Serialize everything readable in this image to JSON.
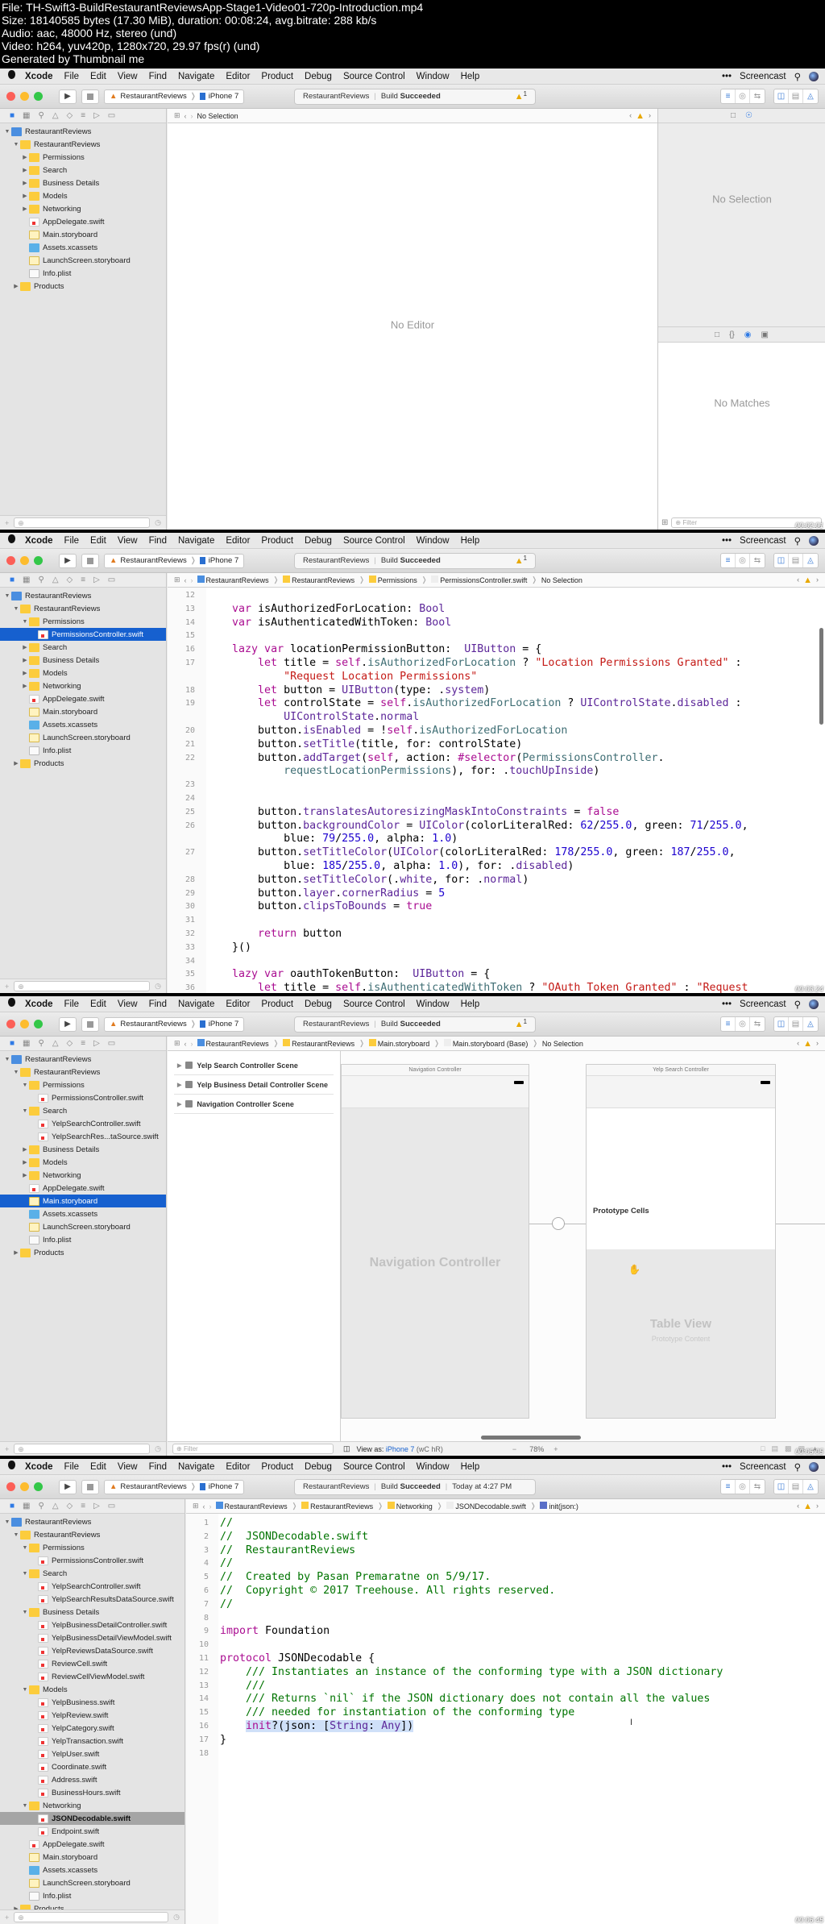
{
  "info": {
    "lines": [
      "File: TH-Swift3-BuildRestaurantReviewsApp-Stage1-Video01-720p-Introduction.mp4",
      "Size: 18140585 bytes (17.30 MiB), duration: 00:08:24, avg.bitrate: 288 kb/s",
      "Audio: aac, 48000 Hz, stereo (und)",
      "Video: h264, yuv420p, 1280x720, 29.97 fps(r) (und)",
      "Generated by Thumbnail me"
    ]
  },
  "menubar": {
    "app": "Xcode",
    "items": [
      "File",
      "Edit",
      "View",
      "Find",
      "Navigate",
      "Editor",
      "Product",
      "Debug",
      "Source Control",
      "Window",
      "Help"
    ],
    "right": [
      "•••",
      "Screencast"
    ],
    "icons": [
      "apple-icon",
      "search-icon",
      "siri-icon"
    ]
  },
  "toolbar": {
    "scheme": "RestaurantReviews",
    "device": "iPhone 7",
    "activity_project": "RestaurantReviews",
    "activity_status_prefix": "Build",
    "activity_status": "Succeeded",
    "warning_count": "1",
    "activity_time": "Today at 4:27 PM"
  },
  "frames": [
    {
      "timestamp": "00:02:01",
      "jumpbar": [
        "No Selection"
      ],
      "editor_message": "No Editor",
      "inspector_top_message": "No Selection",
      "inspector_bottom_message": "No Matches",
      "filter_placeholder": "Filter",
      "tree": [
        {
          "label": "RestaurantReviews",
          "type": "proj",
          "depth": 0,
          "disc": "▼"
        },
        {
          "label": "RestaurantReviews",
          "type": "folder",
          "depth": 1,
          "disc": "▼"
        },
        {
          "label": "Permissions",
          "type": "folder",
          "depth": 2,
          "disc": "▶"
        },
        {
          "label": "Search",
          "type": "folder",
          "depth": 2,
          "disc": "▶"
        },
        {
          "label": "Business Details",
          "type": "folder",
          "depth": 2,
          "disc": "▶"
        },
        {
          "label": "Models",
          "type": "folder",
          "depth": 2,
          "disc": "▶"
        },
        {
          "label": "Networking",
          "type": "folder",
          "depth": 2,
          "disc": "▶"
        },
        {
          "label": "AppDelegate.swift",
          "type": "swift",
          "depth": 2,
          "disc": ""
        },
        {
          "label": "Main.storyboard",
          "type": "sb",
          "depth": 2,
          "disc": ""
        },
        {
          "label": "Assets.xcassets",
          "type": "xc",
          "depth": 2,
          "disc": ""
        },
        {
          "label": "LaunchScreen.storyboard",
          "type": "sb",
          "depth": 2,
          "disc": ""
        },
        {
          "label": "Info.plist",
          "type": "plist",
          "depth": 2,
          "disc": ""
        },
        {
          "label": "Products",
          "type": "folder",
          "depth": 1,
          "disc": "▶"
        }
      ]
    },
    {
      "timestamp": "00:03:24",
      "jumpbar": [
        "RestaurantReviews",
        "RestaurantReviews",
        "Permissions",
        "PermissionsController.swift",
        "No Selection"
      ],
      "tree": [
        {
          "label": "RestaurantReviews",
          "type": "proj",
          "depth": 0,
          "disc": "▼"
        },
        {
          "label": "RestaurantReviews",
          "type": "folder",
          "depth": 1,
          "disc": "▼"
        },
        {
          "label": "Permissions",
          "type": "folder",
          "depth": 2,
          "disc": "▼"
        },
        {
          "label": "PermissionsController.swift",
          "type": "swift",
          "depth": 3,
          "disc": "",
          "selected": true
        },
        {
          "label": "Search",
          "type": "folder",
          "depth": 2,
          "disc": "▶"
        },
        {
          "label": "Business Details",
          "type": "folder",
          "depth": 2,
          "disc": "▶"
        },
        {
          "label": "Models",
          "type": "folder",
          "depth": 2,
          "disc": "▶"
        },
        {
          "label": "Networking",
          "type": "folder",
          "depth": 2,
          "disc": "▶"
        },
        {
          "label": "AppDelegate.swift",
          "type": "swift",
          "depth": 2,
          "disc": ""
        },
        {
          "label": "Main.storyboard",
          "type": "sb",
          "depth": 2,
          "disc": ""
        },
        {
          "label": "Assets.xcassets",
          "type": "xc",
          "depth": 2,
          "disc": ""
        },
        {
          "label": "LaunchScreen.storyboard",
          "type": "sb",
          "depth": 2,
          "disc": ""
        },
        {
          "label": "Info.plist",
          "type": "plist",
          "depth": 2,
          "disc": ""
        },
        {
          "label": "Products",
          "type": "folder",
          "depth": 1,
          "disc": "▶"
        }
      ],
      "code": [
        {
          "n": "12",
          "html": ""
        },
        {
          "n": "13",
          "html": "    <span class='kw'>var</span> isAuthorizedForLocation: <span class='ty'>Bool</span>"
        },
        {
          "n": "14",
          "html": "    <span class='kw'>var</span> isAuthenticatedWithToken: <span class='ty'>Bool</span>"
        },
        {
          "n": "15",
          "html": ""
        },
        {
          "n": "16",
          "html": "    <span class='kw'>lazy var</span> locationPermissionButton:  <span class='ty'>UIButton</span> = {"
        },
        {
          "n": "17",
          "html": "        <span class='kw'>let</span> title = <span class='kw'>self</span>.<span class='pr'>isAuthorizedForLocation</span> ? <span class='str'>\"Location Permissions Granted\"</span> :"
        },
        {
          "n": "",
          "html": "            <span class='str'>\"Request Location Permissions\"</span>"
        },
        {
          "n": "18",
          "html": "        <span class='kw'>let</span> button = <span class='ty'>UIButton</span>(type: .<span class='ty'>system</span>)"
        },
        {
          "n": "19",
          "html": "        <span class='kw'>let</span> controlState = <span class='kw'>self</span>.<span class='pr'>isAuthorizedForLocation</span> ? <span class='ty'>UIControlState</span>.<span class='ty'>disabled</span> :"
        },
        {
          "n": "",
          "html": "            <span class='ty'>UIControlState</span>.<span class='ty'>normal</span>"
        },
        {
          "n": "20",
          "html": "        button.<span class='ty'>isEnabled</span> = !<span class='kw'>self</span>.<span class='pr'>isAuthorizedForLocation</span>"
        },
        {
          "n": "21",
          "html": "        button.<span class='ty'>setTitle</span>(title, for: controlState)"
        },
        {
          "n": "22",
          "html": "        button.<span class='ty'>addTarget</span>(<span class='kw'>self</span>, action: <span class='kw'>#selector</span>(<span class='pr'>PermissionsController</span>."
        },
        {
          "n": "",
          "html": "            <span class='pr'>requestLocationPermissions</span>), for: .<span class='ty'>touchUpInside</span>)"
        },
        {
          "n": "23",
          "html": ""
        },
        {
          "n": "24",
          "html": ""
        },
        {
          "n": "25",
          "html": "        button.<span class='ty'>translatesAutoresizingMaskIntoConstraints</span> = <span class='kw'>false</span>"
        },
        {
          "n": "26",
          "html": "        button.<span class='ty'>backgroundColor</span> = <span class='ty'>UIColor</span>(colorLiteralRed: <span class='num'>62</span>/<span class='num'>255.0</span>, green: <span class='num'>71</span>/<span class='num'>255.0</span>,"
        },
        {
          "n": "",
          "html": "            blue: <span class='num'>79</span>/<span class='num'>255.0</span>, alpha: <span class='num'>1.0</span>)"
        },
        {
          "n": "27",
          "html": "        button.<span class='ty'>setTitleColor</span>(<span class='ty'>UIColor</span>(colorLiteralRed: <span class='num'>178</span>/<span class='num'>255.0</span>, green: <span class='num'>187</span>/<span class='num'>255.0</span>,"
        },
        {
          "n": "",
          "html": "            blue: <span class='num'>185</span>/<span class='num'>255.0</span>, alpha: <span class='num'>1.0</span>), for: .<span class='ty'>disabled</span>)"
        },
        {
          "n": "28",
          "html": "        button.<span class='ty'>setTitleColor</span>(.<span class='ty'>white</span>, for: .<span class='ty'>normal</span>)"
        },
        {
          "n": "29",
          "html": "        button.<span class='ty'>layer</span>.<span class='ty'>cornerRadius</span> = <span class='num'>5</span>"
        },
        {
          "n": "30",
          "html": "        button.<span class='ty'>clipsToBounds</span> = <span class='kw'>true</span>"
        },
        {
          "n": "31",
          "html": ""
        },
        {
          "n": "32",
          "html": "        <span class='kw'>return</span> button"
        },
        {
          "n": "33",
          "html": "    }()"
        },
        {
          "n": "34",
          "html": ""
        },
        {
          "n": "35",
          "html": "    <span class='kw'>lazy var</span> oauthTokenButton:  <span class='ty'>UIButton</span> = {"
        },
        {
          "n": "36",
          "html": "        <span class='kw'>let</span> title = <span class='kw'>self</span>.<span class='pr'>isAuthenticatedWithToken</span> ? <span class='str'>\"OAuth Token Granted\"</span> : <span class='str'>\"Request</span>"
        }
      ]
    },
    {
      "timestamp": "00:05:05",
      "jumpbar": [
        "RestaurantReviews",
        "RestaurantReviews",
        "Main.storyboard",
        "Main.storyboard (Base)",
        "No Selection"
      ],
      "tree": [
        {
          "label": "RestaurantReviews",
          "type": "proj",
          "depth": 0,
          "disc": "▼"
        },
        {
          "label": "RestaurantReviews",
          "type": "folder",
          "depth": 1,
          "disc": "▼"
        },
        {
          "label": "Permissions",
          "type": "folder",
          "depth": 2,
          "disc": "▼"
        },
        {
          "label": "PermissionsController.swift",
          "type": "swift",
          "depth": 3,
          "disc": ""
        },
        {
          "label": "Search",
          "type": "folder",
          "depth": 2,
          "disc": "▼"
        },
        {
          "label": "YelpSearchController.swift",
          "type": "swift",
          "depth": 3,
          "disc": ""
        },
        {
          "label": "YelpSearchRes...taSource.swift",
          "type": "swift",
          "depth": 3,
          "disc": ""
        },
        {
          "label": "Business Details",
          "type": "folder",
          "depth": 2,
          "disc": "▶"
        },
        {
          "label": "Models",
          "type": "folder",
          "depth": 2,
          "disc": "▶"
        },
        {
          "label": "Networking",
          "type": "folder",
          "depth": 2,
          "disc": "▶"
        },
        {
          "label": "AppDelegate.swift",
          "type": "swift",
          "depth": 2,
          "disc": ""
        },
        {
          "label": "Main.storyboard",
          "type": "sb",
          "depth": 2,
          "disc": "",
          "selected": true
        },
        {
          "label": "Assets.xcassets",
          "type": "xc",
          "depth": 2,
          "disc": ""
        },
        {
          "label": "LaunchScreen.storyboard",
          "type": "sb",
          "depth": 2,
          "disc": ""
        },
        {
          "label": "Info.plist",
          "type": "plist",
          "depth": 2,
          "disc": ""
        },
        {
          "label": "Products",
          "type": "folder",
          "depth": 1,
          "disc": "▶"
        }
      ],
      "outline": [
        "Yelp Search Controller Scene",
        "Yelp Business Detail Controller Scene",
        "Navigation Controller Scene"
      ],
      "scene_nav_title": "Navigation Controller",
      "scene_nav_body": "Navigation Controller",
      "scene_search_title": "Yelp Search Controller",
      "prototype_cells": "Prototype Cells",
      "table_view": "Table View",
      "prototype_content": "Prototype Content",
      "view_as_prefix": "View as: ",
      "view_as_device": "iPhone 7",
      "view_as_traits": "(wC hR)",
      "zoom_level": "78%",
      "filter_placeholder": "Filter"
    },
    {
      "timestamp": "00:06:45",
      "jumpbar": [
        "RestaurantReviews",
        "RestaurantReviews",
        "Networking",
        "JSONDecodable.swift",
        "init(json:)"
      ],
      "tree": [
        {
          "label": "RestaurantReviews",
          "type": "proj",
          "depth": 0,
          "disc": "▼"
        },
        {
          "label": "RestaurantReviews",
          "type": "folder",
          "depth": 1,
          "disc": "▼"
        },
        {
          "label": "Permissions",
          "type": "folder",
          "depth": 2,
          "disc": "▼"
        },
        {
          "label": "PermissionsController.swift",
          "type": "swift",
          "depth": 3,
          "disc": ""
        },
        {
          "label": "Search",
          "type": "folder",
          "depth": 2,
          "disc": "▼"
        },
        {
          "label": "YelpSearchController.swift",
          "type": "swift",
          "depth": 3,
          "disc": ""
        },
        {
          "label": "YelpSearchResultsDataSource.swift",
          "type": "swift",
          "depth": 3,
          "disc": ""
        },
        {
          "label": "Business Details",
          "type": "folder",
          "depth": 2,
          "disc": "▼"
        },
        {
          "label": "YelpBusinessDetailController.swift",
          "type": "swift",
          "depth": 3,
          "disc": ""
        },
        {
          "label": "YelpBusinessDetailViewModel.swift",
          "type": "swift",
          "depth": 3,
          "disc": ""
        },
        {
          "label": "YelpReviewsDataSource.swift",
          "type": "swift",
          "depth": 3,
          "disc": ""
        },
        {
          "label": "ReviewCell.swift",
          "type": "swift",
          "depth": 3,
          "disc": ""
        },
        {
          "label": "ReviewCellViewModel.swift",
          "type": "swift",
          "depth": 3,
          "disc": ""
        },
        {
          "label": "Models",
          "type": "folder",
          "depth": 2,
          "disc": "▼"
        },
        {
          "label": "YelpBusiness.swift",
          "type": "swift",
          "depth": 3,
          "disc": ""
        },
        {
          "label": "YelpReview.swift",
          "type": "swift",
          "depth": 3,
          "disc": ""
        },
        {
          "label": "YelpCategory.swift",
          "type": "swift",
          "depth": 3,
          "disc": ""
        },
        {
          "label": "YelpTransaction.swift",
          "type": "swift",
          "depth": 3,
          "disc": ""
        },
        {
          "label": "YelpUser.swift",
          "type": "swift",
          "depth": 3,
          "disc": ""
        },
        {
          "label": "Coordinate.swift",
          "type": "swift",
          "depth": 3,
          "disc": ""
        },
        {
          "label": "Address.swift",
          "type": "swift",
          "depth": 3,
          "disc": ""
        },
        {
          "label": "BusinessHours.swift",
          "type": "swift",
          "depth": 3,
          "disc": ""
        },
        {
          "label": "Networking",
          "type": "folder",
          "depth": 2,
          "disc": "▼"
        },
        {
          "label": "JSONDecodable.swift",
          "type": "swift",
          "depth": 3,
          "disc": "",
          "selectedGray": true
        },
        {
          "label": "Endpoint.swift",
          "type": "swift",
          "depth": 3,
          "disc": ""
        },
        {
          "label": "AppDelegate.swift",
          "type": "swift",
          "depth": 2,
          "disc": ""
        },
        {
          "label": "Main.storyboard",
          "type": "sb",
          "depth": 2,
          "disc": ""
        },
        {
          "label": "Assets.xcassets",
          "type": "xc",
          "depth": 2,
          "disc": ""
        },
        {
          "label": "LaunchScreen.storyboard",
          "type": "sb",
          "depth": 2,
          "disc": ""
        },
        {
          "label": "Info.plist",
          "type": "plist",
          "depth": 2,
          "disc": ""
        },
        {
          "label": "Products",
          "type": "folder",
          "depth": 1,
          "disc": "▶"
        }
      ],
      "code": [
        {
          "n": "1",
          "html": "<span class='cm'>//</span>"
        },
        {
          "n": "2",
          "html": "<span class='cm'>//  JSONDecodable.swift</span>"
        },
        {
          "n": "3",
          "html": "<span class='cm'>//  RestaurantReviews</span>"
        },
        {
          "n": "4",
          "html": "<span class='cm'>//</span>"
        },
        {
          "n": "5",
          "html": "<span class='cm'>//  Created by Pasan Premaratne on 5/9/17.</span>"
        },
        {
          "n": "6",
          "html": "<span class='cm'>//  Copyright © 2017 Treehouse. All rights reserved.</span>"
        },
        {
          "n": "7",
          "html": "<span class='cm'>//</span>"
        },
        {
          "n": "8",
          "html": ""
        },
        {
          "n": "9",
          "html": "<span class='kw'>import</span> Foundation"
        },
        {
          "n": "10",
          "html": ""
        },
        {
          "n": "11",
          "html": "<span class='kw'>protocol</span> JSONDecodable {"
        },
        {
          "n": "12",
          "html": "    <span class='cm'>/// Instantiates an instance of the conforming type with a JSON dictionary</span>"
        },
        {
          "n": "13",
          "html": "    <span class='cm'>///</span>"
        },
        {
          "n": "14",
          "html": "    <span class='cm'>/// Returns `nil` if the JSON dictionary does not contain all the values</span>"
        },
        {
          "n": "15",
          "html": "    <span class='cm'>/// needed for instantiation of the conforming type</span>"
        },
        {
          "n": "16",
          "html": "    <span style='background:#cfe0f8'><span class='kw'>init</span>?(json: [<span class='ty'>String</span>: <span class='ty'>Any</span>])</span>"
        },
        {
          "n": "17",
          "html": "}"
        },
        {
          "n": "18",
          "html": ""
        }
      ]
    }
  ]
}
